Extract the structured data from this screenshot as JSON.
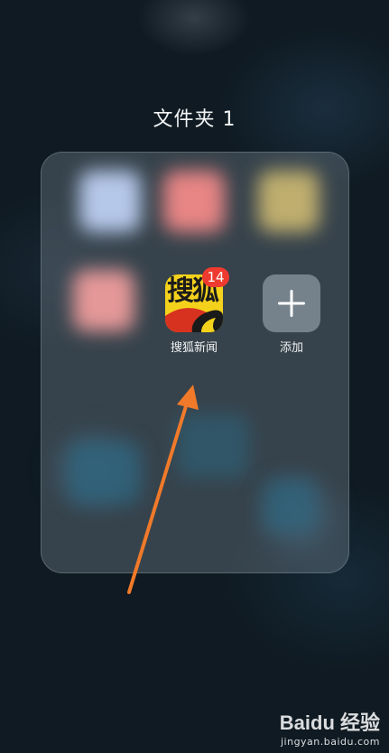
{
  "folder": {
    "title": "文件夹 1"
  },
  "apps": [
    {
      "name": "搜狐新闻",
      "badge": "14",
      "icon": "sohu-news-icon",
      "icon_text": "搜狐"
    },
    {
      "name": "添加",
      "icon": "plus-icon"
    }
  ],
  "watermark": {
    "logo": "Baidu 经验",
    "url": "jingyan.baidu.com"
  },
  "colors": {
    "sohu_yellow": "#f4d21c",
    "badge_red": "#ee3a2f",
    "annotation_arrow": "#f07a2a"
  }
}
